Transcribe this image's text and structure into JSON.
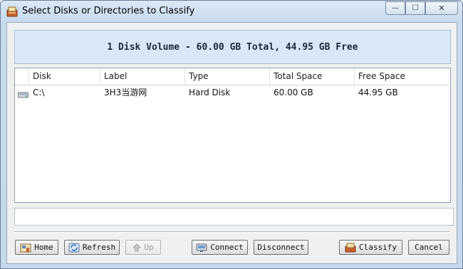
{
  "window": {
    "title": "Select Disks or Directories to Classify"
  },
  "caption_buttons": {
    "minimize": "—",
    "maximize": "☐",
    "close": "✕"
  },
  "summary": "1 Disk Volume - 60.00 GB Total, 44.95 GB Free",
  "table": {
    "columns": [
      "Disk",
      "Label",
      "Type",
      "Total Space",
      "Free Space"
    ],
    "rows": [
      {
        "icon": "hard-disk-icon",
        "disk": "C:\\",
        "label": "3H3当游网",
        "type": "Hard Disk",
        "total": "60.00 GB",
        "free": "44.95 GB"
      }
    ]
  },
  "path_value": "",
  "buttons": {
    "home": {
      "label": "Home",
      "icon": "home-icon",
      "enabled": true
    },
    "refresh": {
      "label": "Refresh",
      "icon": "refresh-icon",
      "enabled": true
    },
    "up": {
      "label": "Up",
      "icon": "up-arrow-icon",
      "enabled": false
    },
    "connect": {
      "label": "Connect",
      "icon": "connect-icon",
      "enabled": true
    },
    "disconnect": {
      "label": "Disconnect",
      "enabled": true
    },
    "classify": {
      "label": "Classify",
      "icon": "classify-icon",
      "enabled": true
    },
    "cancel": {
      "label": "Cancel",
      "enabled": true
    }
  }
}
